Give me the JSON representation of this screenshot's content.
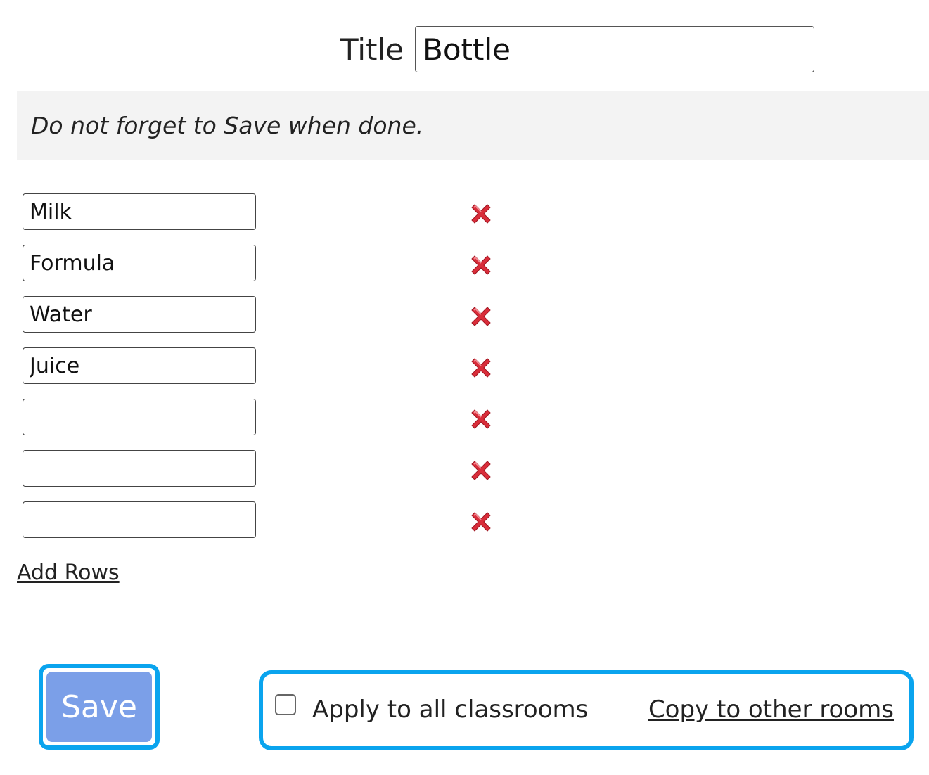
{
  "title": {
    "label": "Title",
    "value": "Bottle"
  },
  "notice": "Do not forget to Save when done.",
  "rows": [
    {
      "value": "Milk"
    },
    {
      "value": "Formula"
    },
    {
      "value": "Water"
    },
    {
      "value": "Juice"
    },
    {
      "value": ""
    },
    {
      "value": ""
    },
    {
      "value": ""
    }
  ],
  "add_rows_label": "Add Rows",
  "save_label": "Save",
  "apply_all_label": "Apply to all classrooms",
  "apply_all_checked": false,
  "copy_link_label": "Copy to other rooms",
  "icons": {
    "delete": "delete-x-icon"
  },
  "colors": {
    "save_button": "#7b9fe8",
    "highlight_border": "#0aa4ee",
    "delete_icon": "#d92d3a",
    "notice_bg": "#f3f3f3"
  }
}
